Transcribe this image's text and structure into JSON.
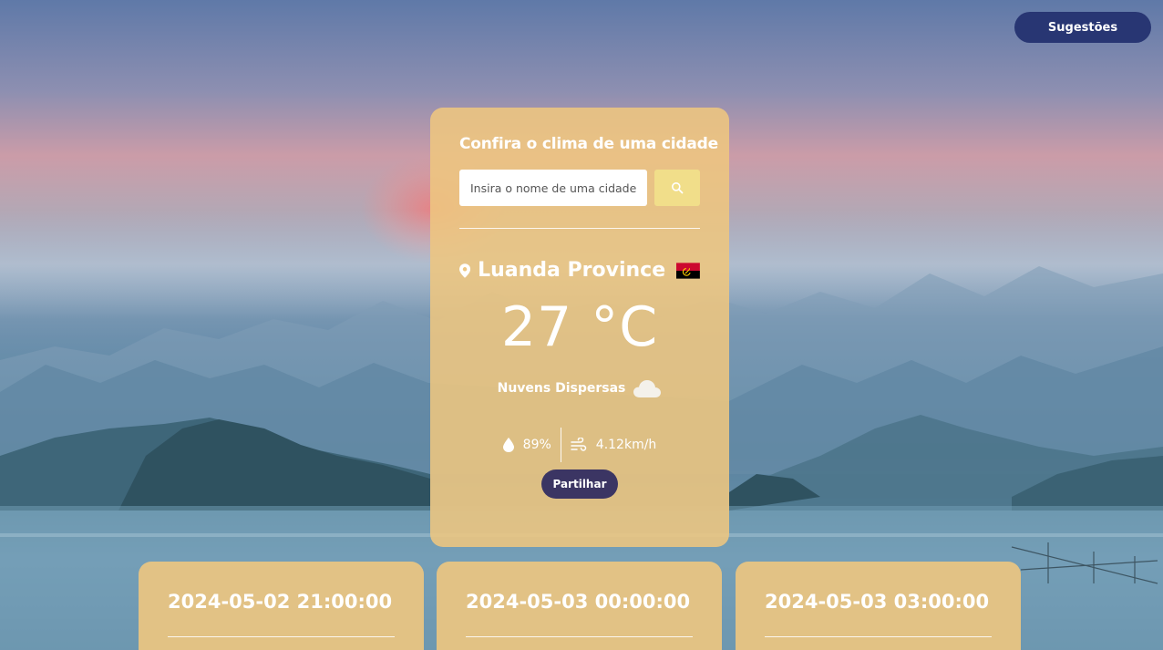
{
  "header": {
    "suggestions_label": "Sugestões"
  },
  "card": {
    "title": "Confira o clima de uma cidade",
    "search_placeholder": "Insira o nome de uma cidade",
    "search_icon": "search-icon",
    "city": "Luanda Province",
    "location_icon": "map-pin-icon",
    "country_flag": "angola-flag",
    "temperature": "27 °C",
    "description": "Nuvens Dispersas",
    "weather_icon": "cloud-icon",
    "humidity": "89%",
    "humidity_icon": "water-drop-icon",
    "wind": "4.12km/h",
    "wind_icon": "wind-icon",
    "share_label": "Partilhar"
  },
  "forecast": [
    {
      "date": "2024-05-02 21:00:00"
    },
    {
      "date": "2024-05-03 00:00:00"
    },
    {
      "date": "2024-05-03 03:00:00"
    }
  ],
  "colors": {
    "card_bg": "#eec680",
    "suggestions_button": "#283673",
    "share_button": "#3b3563",
    "search_button": "#f1de8a"
  }
}
